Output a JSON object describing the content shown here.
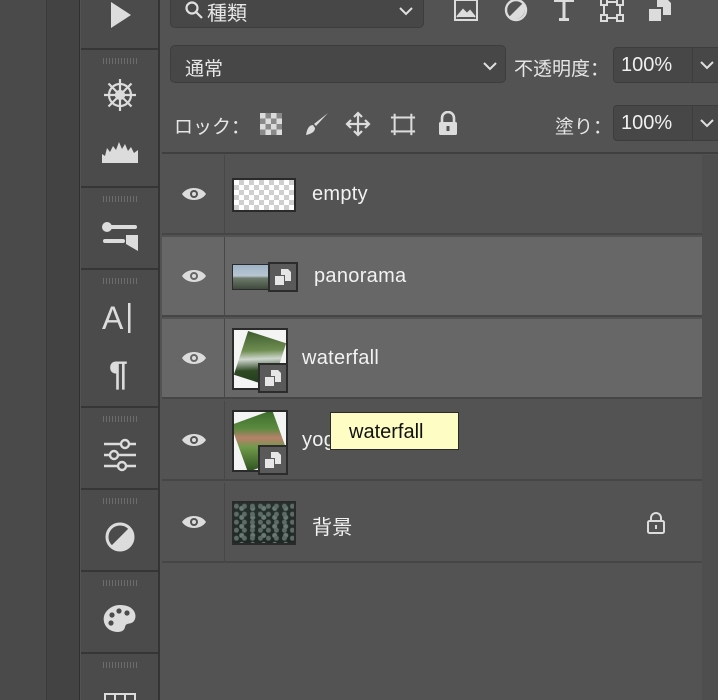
{
  "panel": {
    "kind_filter": {
      "label": "種類",
      "icon": "search-icon"
    },
    "filter_icons": [
      "image-filter-icon",
      "adjustment-filter-icon",
      "type-filter-icon",
      "shape-filter-icon",
      "smart-object-filter-icon"
    ],
    "blend_mode": "通常",
    "opacity_label": "不透明度：",
    "opacity_value": "100%",
    "lock_label": "ロック：",
    "lock_icons": [
      "lock-transparent-pixels-icon",
      "lock-image-pixels-icon",
      "lock-position-icon",
      "lock-artboard-icon",
      "lock-all-icon"
    ],
    "fill_label": "塗り：",
    "fill_value": "100%"
  },
  "layers": [
    {
      "name": "empty",
      "type": "pixel",
      "visible": true,
      "selected": false
    },
    {
      "name": "panorama",
      "type": "smart-object",
      "visible": true,
      "selected": true
    },
    {
      "name": "waterfall",
      "type": "smart-object",
      "visible": true,
      "selected": true
    },
    {
      "name": "yoga",
      "type": "smart-object",
      "visible": true,
      "selected": false
    },
    {
      "name": "背景",
      "type": "background",
      "visible": true,
      "selected": false,
      "locked": true
    }
  ],
  "tooltip": {
    "text": "waterfall"
  },
  "tools": [
    "play-icon",
    "brush-preset-icon",
    "histogram-icon",
    "properties-icon",
    "character-icon",
    "paragraph-icon",
    "adjustments-icon",
    "styles-icon",
    "swatches-icon",
    "grid-icon"
  ],
  "colors": {
    "panel_bg": "#535353",
    "selected_row": "#676767",
    "tooltip_bg": "#fdfdc4"
  }
}
